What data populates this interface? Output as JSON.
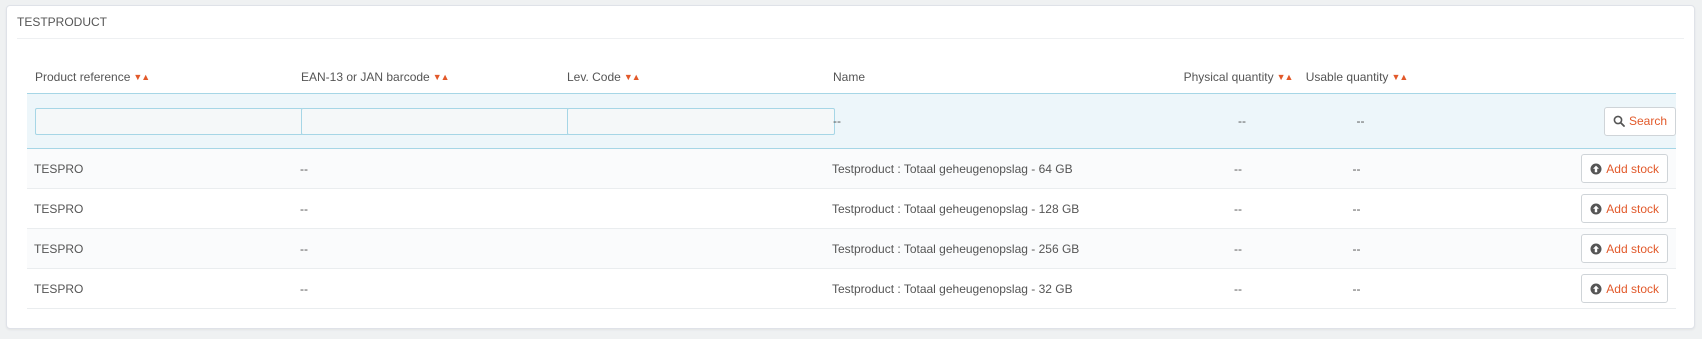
{
  "panel": {
    "title": "TESTPRODUCT"
  },
  "table": {
    "columns": [
      {
        "label": "Product reference",
        "sortable": true
      },
      {
        "label": "EAN-13 or JAN barcode",
        "sortable": true
      },
      {
        "label": "Lev. Code",
        "sortable": true
      },
      {
        "label": "Name",
        "sortable": false
      },
      {
        "label": "Physical quantity",
        "sortable": true
      },
      {
        "label": "Usable quantity",
        "sortable": true
      }
    ],
    "sort_icons": "▼▲",
    "filter": {
      "reference_value": "",
      "barcode_value": "",
      "lev_code_value": "",
      "name_placeholder": "--",
      "physical_placeholder": "--",
      "usable_placeholder": "--",
      "search_label": "Search"
    },
    "rows": [
      {
        "reference": "TESPRO",
        "barcode": "--",
        "lev_code": "",
        "name": "Testproduct : Totaal geheugenopslag - 64 GB",
        "physical": "--",
        "usable": "--",
        "action": "Add stock"
      },
      {
        "reference": "TESPRO",
        "barcode": "--",
        "lev_code": "",
        "name": "Testproduct : Totaal geheugenopslag - 128 GB",
        "physical": "--",
        "usable": "--",
        "action": "Add stock"
      },
      {
        "reference": "TESPRO",
        "barcode": "--",
        "lev_code": "",
        "name": "Testproduct : Totaal geheugenopslag - 256 GB",
        "physical": "--",
        "usable": "--",
        "action": "Add stock"
      },
      {
        "reference": "TESPRO",
        "barcode": "--",
        "lev_code": "",
        "name": "Testproduct : Totaal geheugenopslag - 32 GB",
        "physical": "--",
        "usable": "--",
        "action": "Add stock"
      }
    ]
  },
  "colors": {
    "accent": "#e2592a",
    "filter_bg": "#edf6fa",
    "border_blue": "#a6d6e6"
  },
  "icons": {
    "search": "search-icon",
    "add_stock": "arrow-circle-up-icon"
  }
}
